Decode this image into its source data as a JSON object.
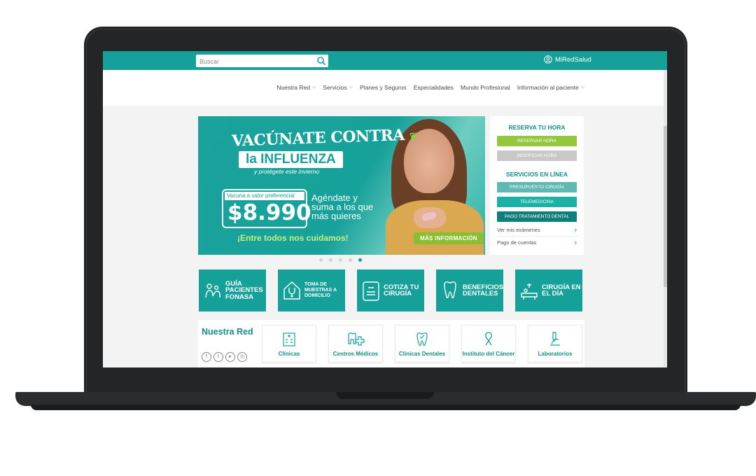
{
  "topbar": {
    "search_placeholder": "Buscar",
    "account_label": "MiRedSalud",
    "accent_color": "#16a09a"
  },
  "nav": {
    "items": [
      {
        "label": "Nuestra Red",
        "dropdown": true
      },
      {
        "label": "Servicios",
        "dropdown": true
      },
      {
        "label": "Planes y Seguros",
        "dropdown": false
      },
      {
        "label": "Especialidades",
        "dropdown": false
      },
      {
        "label": "Mundo Profesional",
        "dropdown": false
      },
      {
        "label": "Información al paciente",
        "dropdown": true
      }
    ]
  },
  "hero": {
    "title_line1": "VACÚNATE CONTRA",
    "title_line2": "la INFLUENZA",
    "title_line3": "y protégete este invierno",
    "price_label": "Vacuna a valor preferencial",
    "price": "$8.990",
    "side_text": "Agéndate y suma a los que más quieres",
    "slogan": "¡Entre todos nos cuidamos!",
    "cta": "MÁS INFORMACIÓN",
    "slides_total": 5,
    "active_slide": 5
  },
  "panel": {
    "reserva_title": "RESERVA TU HORA",
    "reservar": "RESERVAR HORA",
    "modificar": "MODIFICAR HORA",
    "servicios_title": "SERVICIOS EN LÍNEA",
    "presupuesto": "PRESUPUESTO CIRUGÍA",
    "telemedicina": "TELEMEDICINA",
    "pago_dental": "PAGO TRATAMIENTO DENTAL",
    "links": [
      "Ver mis exámenes",
      "Pago de cuentas"
    ]
  },
  "tiles": [
    {
      "label": "GUÍA PACIENTES FONASA",
      "icon": "family-icon"
    },
    {
      "label": "TOMA DE MUESTRAS A DOMICILIO",
      "icon": "house-stethoscope-icon"
    },
    {
      "label": "COTIZA TU CIRUGÍA",
      "icon": "surgery-calculator-icon"
    },
    {
      "label": "BENEFICIOS DENTALES",
      "icon": "tooth-icon"
    },
    {
      "label": "CIRUGÍA EN EL DÍA",
      "icon": "surgery-bed-icon"
    }
  ],
  "red": {
    "title": "Nuestra Red",
    "cards": [
      {
        "label": "Clínicas",
        "icon": "hospital-icon"
      },
      {
        "label": "Centros Médicos",
        "icon": "medical-cross-icon"
      },
      {
        "label": "Clínicas Dentales",
        "icon": "tooth-check-icon"
      },
      {
        "label": "Instituto del Cáncer",
        "icon": "ribbon-icon"
      },
      {
        "label": "Laboratorios",
        "icon": "microscope-icon"
      }
    ],
    "social": [
      "facebook-icon",
      "twitter-icon",
      "youtube-icon",
      "instagram-icon"
    ]
  }
}
